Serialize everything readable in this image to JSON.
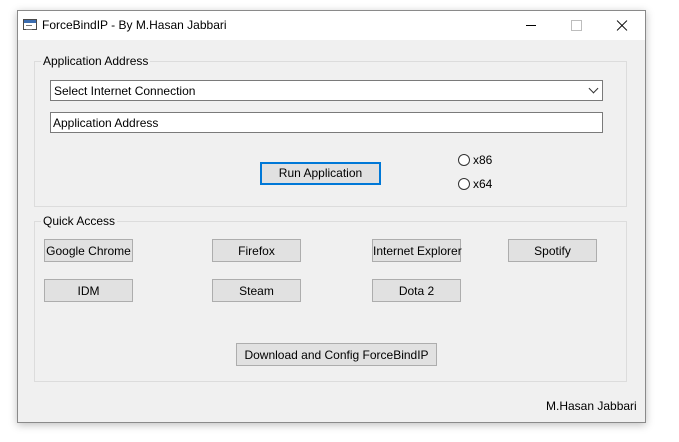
{
  "window": {
    "title": "ForceBindIP - By M.Hasan Jabbari",
    "icon": "application-window-icon"
  },
  "title_buttons": {
    "minimize": "minimize-icon",
    "maximize": "maximize-icon",
    "close": "close-icon"
  },
  "application_address": {
    "legend": "Application Address",
    "connection_select": {
      "selected": "Select Internet Connection"
    },
    "address_field": {
      "value": "Application Address"
    },
    "run_button": "Run Application",
    "architecture": [
      {
        "label": "x86",
        "checked": false
      },
      {
        "label": "x64",
        "checked": false
      }
    ]
  },
  "quick_access": {
    "legend": "Quick Access",
    "buttons": [
      "Google Chrome",
      "Firefox",
      "Internet Explorer",
      "Spotify",
      "IDM",
      "Steam",
      "Dota 2"
    ],
    "download_button": "Download and Config ForceBindIP"
  },
  "footer": {
    "author": "M.Hasan Jabbari"
  },
  "colors": {
    "window_bg": "#f0f0f0",
    "focus_border": "#0078d7",
    "button_bg": "#e1e1e1"
  }
}
